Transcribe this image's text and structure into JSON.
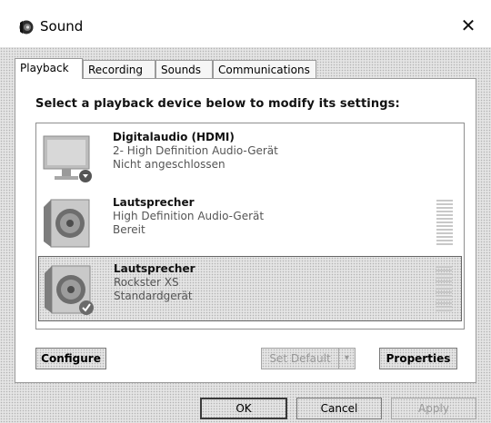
{
  "window": {
    "title": "Sound",
    "close_glyph": "✕"
  },
  "tabs": [
    {
      "label": "Playback",
      "active": true
    },
    {
      "label": "Recording",
      "active": false
    },
    {
      "label": "Sounds",
      "active": false
    },
    {
      "label": "Communications",
      "active": false
    }
  ],
  "instruction": "Select a playback device below to modify its settings:",
  "devices": [
    {
      "name": "Digitalaudio (HDMI)",
      "description": "2- High Definition Audio-Gerät",
      "status": "Nicht angeschlossen",
      "icon": "monitor-icon",
      "selected": false,
      "default": false
    },
    {
      "name": "Lautsprecher",
      "description": "High Definition Audio-Gerät",
      "status": "Bereit",
      "icon": "speaker-icon",
      "selected": false,
      "default": false
    },
    {
      "name": "Lautsprecher",
      "description": "Rockster XS",
      "status": "Standardgerät",
      "icon": "speaker-icon",
      "selected": true,
      "default": true
    }
  ],
  "buttons": {
    "configure": "Configure",
    "set_default": "Set Default",
    "set_default_arrow": "▾",
    "properties": "Properties",
    "ok": "OK",
    "cancel": "Cancel",
    "apply": "Apply"
  },
  "colors": {
    "selected_row": "#e0e0e0",
    "disabled_text": "#9a9a9a"
  }
}
